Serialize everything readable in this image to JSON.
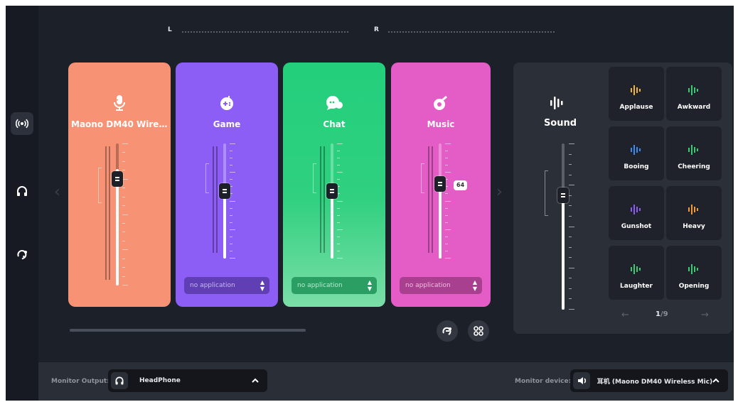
{
  "balance": {
    "left_label": "L",
    "right_label": "R"
  },
  "sidebar": {
    "items": [
      {
        "icon": "broadcast-icon",
        "active": true
      },
      {
        "icon": "headphone-icon",
        "active": false
      },
      {
        "icon": "loop-icon",
        "active": false
      }
    ]
  },
  "channels": [
    {
      "name": "Maono DM40 Wirel...",
      "icon": "microphone-icon",
      "color": "#f79274",
      "level": 0.82
    },
    {
      "name": "Game",
      "icon": "gamepad-icon",
      "color": "#8c5ef5",
      "level": 0.62,
      "app": "no application"
    },
    {
      "name": "Chat",
      "icon": "chat-bubble-icon",
      "color": "#2fcf80",
      "level": 0.62,
      "app": "no application"
    },
    {
      "name": "Music",
      "icon": "music-note-icon",
      "color": "#e45cc6",
      "level": 0.64,
      "value_badge": "64",
      "app": "no application"
    }
  ],
  "sound": {
    "title": "Sound",
    "icon": "sound-wave-icon",
    "level": 0.68,
    "effects": [
      {
        "label": "Applause",
        "color": "#f2b52a"
      },
      {
        "label": "Awkward",
        "color": "#3ec872"
      },
      {
        "label": "Booing",
        "color": "#3a8cf0"
      },
      {
        "label": "Cheering",
        "color": "#3ec872"
      },
      {
        "label": "Gunshot",
        "color": "#8a5cf0"
      },
      {
        "label": "Heavy",
        "color": "#f29a3a"
      },
      {
        "label": "Laughter",
        "color": "#3ec872"
      },
      {
        "label": "Opening",
        "color": "#3ec872"
      }
    ],
    "pager": {
      "current": "1",
      "total": "/9"
    }
  },
  "footer": {
    "monitor_output_label": "Monitor Output:",
    "monitor_output_value": "HeadPhone",
    "monitor_device_label": "Monitor device:",
    "monitor_device_value": "耳机 (Maono DM40 Wireless Mic)"
  }
}
